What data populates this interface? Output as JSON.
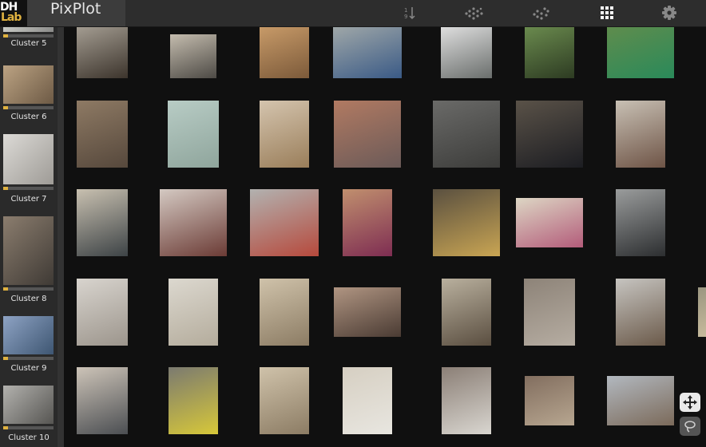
{
  "app": {
    "logo_top": "DH",
    "logo_bottom": "Lab",
    "title": "PixPlot"
  },
  "toolbar": [
    {
      "icon": "sort-layout-icon",
      "active": false
    },
    {
      "icon": "umap-scatter-layout-icon",
      "active": false
    },
    {
      "icon": "cluster-layout-icon",
      "active": false
    },
    {
      "icon": "grid-layout-icon",
      "active": true
    },
    {
      "icon": "settings-gear-icon",
      "active": false
    }
  ],
  "sidebar": {
    "clusters": [
      {
        "label": "Cluster 5",
        "colors": [
          "#cfd1cc",
          "#8a8a88"
        ],
        "progress": 0.1
      },
      {
        "label": "Cluster 6",
        "colors": [
          "#bca383",
          "#6d5a45"
        ],
        "progress": 0.1
      },
      {
        "label": "Cluster 7",
        "colors": [
          "#dcdad6",
          "#9e9b96"
        ],
        "progress": 0.1
      },
      {
        "label": "Cluster 8",
        "colors": [
          "#8b7d6e",
          "#3f3a35"
        ],
        "progress": 0.1
      },
      {
        "label": "Cluster 9",
        "colors": [
          "#8ea3c4",
          "#3e5672"
        ],
        "progress": 0.1
      },
      {
        "label": "Cluster 10",
        "colors": [
          "#b3b2ae",
          "#565552"
        ],
        "progress": 0.1
      }
    ]
  },
  "grid": {
    "rows": [
      [
        {
          "name": "dark-doorway-photo",
          "colors": [
            "#a39c91",
            "#3c342c"
          ]
        },
        {
          "name": "building-entrance-photo",
          "colors": [
            "#c4bcae",
            "#4d4a45"
          ]
        },
        {
          "name": "wooden-panel-door-photo",
          "colors": [
            "#c79a68",
            "#7c5a3a"
          ]
        },
        {
          "name": "scaffold-blue-tarp-photo",
          "colors": [
            "#9fa7a8",
            "#3a5a86"
          ]
        },
        {
          "name": "white-gate-photo",
          "colors": [
            "#dedede",
            "#6a6e6c"
          ]
        },
        {
          "name": "green-vines-fence-photo",
          "colors": [
            "#6a8a4e",
            "#2d3b22"
          ]
        },
        {
          "name": "green-sign-post-photo",
          "colors": [
            "#5f8c4d",
            "#2a8a5a"
          ]
        }
      ],
      [
        {
          "name": "brown-metal-door-photo",
          "colors": [
            "#8e7a64",
            "#56483c"
          ]
        },
        {
          "name": "riveted-white-door-photo",
          "colors": [
            "#b8ccc5",
            "#8fa59c"
          ]
        },
        {
          "name": "wooden-door-pillar-photo",
          "colors": [
            "#d4c4ae",
            "#9a7e5a"
          ]
        },
        {
          "name": "brick-building-photo",
          "colors": [
            "#b17a62",
            "#6b5a58"
          ]
        },
        {
          "name": "grey-sign-wall-photo",
          "colors": [
            "#6a6a68",
            "#3c3c3a"
          ]
        },
        {
          "name": "dark-corridor-photo",
          "colors": [
            "#5a5248",
            "#1c1d22"
          ]
        },
        {
          "name": "pillar-poster-photo",
          "colors": [
            "#c8c0b4",
            "#6e5446"
          ]
        }
      ],
      [
        {
          "name": "dark-glass-door-photo",
          "colors": [
            "#c8c0b0",
            "#3d4346"
          ]
        },
        {
          "name": "rusty-plate-wall-photo",
          "colors": [
            "#d4c9c2",
            "#6b3b35"
          ]
        },
        {
          "name": "red-valve-pipes-photo",
          "colors": [
            "#b2b2b0",
            "#b6493c"
          ]
        },
        {
          "name": "selfie-person-photo",
          "colors": [
            "#c08f6e",
            "#7e2d52"
          ]
        },
        {
          "name": "yellow-railing-photo",
          "colors": [
            "#5a5040",
            "#c9a553"
          ]
        },
        {
          "name": "poster-wall-photo",
          "colors": [
            "#ddd6c4",
            "#b35c7a"
          ]
        },
        {
          "name": "dark-kiosk-photo",
          "colors": [
            "#9a9c9c",
            "#2c2e30"
          ]
        }
      ],
      [
        {
          "name": "white-door-dark-windows-photo",
          "colors": [
            "#d8d4ce",
            "#9c958c"
          ]
        },
        {
          "name": "white-door-photo",
          "colors": [
            "#dcd8cf",
            "#b4ac9c"
          ]
        },
        {
          "name": "slatted-door-photo",
          "colors": [
            "#cfc2aa",
            "#8c7c64"
          ]
        },
        {
          "name": "brick-wall-door-photo",
          "colors": [
            "#b09582",
            "#4a3b33"
          ]
        },
        {
          "name": "arched-facade-photo",
          "colors": [
            "#b9b09e",
            "#5a4e40"
          ]
        },
        {
          "name": "stone-wall-panel-photo",
          "colors": [
            "#8d8378",
            "#b6ada2"
          ]
        },
        {
          "name": "tree-facade-photo",
          "colors": [
            "#c6c4c0",
            "#6b5a4a"
          ]
        },
        {
          "name": "partial-edge-photo",
          "colors": [
            "#9b9680",
            "#c6ba9c"
          ]
        }
      ],
      [
        {
          "name": "grey-double-door-photo",
          "colors": [
            "#cdc4b8",
            "#4b4e52"
          ]
        },
        {
          "name": "yellow-gate-photo",
          "colors": [
            "#7b7a70",
            "#d7c839"
          ]
        },
        {
          "name": "slatted-door-2-photo",
          "colors": [
            "#cfc2aa",
            "#8c7c64"
          ]
        },
        {
          "name": "white-door-2-photo",
          "colors": [
            "#d6cfc2",
            "#e8e6e0"
          ]
        },
        {
          "name": "stone-wall-white-panel-photo",
          "colors": [
            "#8b7f76",
            "#d9d6d0"
          ]
        },
        {
          "name": "stacked-debris-photo",
          "colors": [
            "#826e5f",
            "#b7a690"
          ]
        },
        {
          "name": "construction-site-photo",
          "colors": [
            "#b2b8bf",
            "#7b6a5a"
          ]
        }
      ]
    ]
  },
  "zoom_controls": [
    {
      "icon": "pan-move-icon",
      "active": true
    },
    {
      "icon": "lasso-select-icon",
      "active": false
    }
  ]
}
